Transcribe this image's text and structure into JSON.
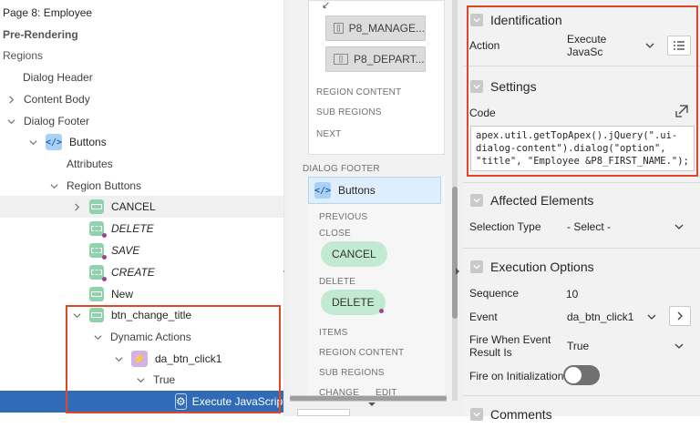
{
  "tree": {
    "page_title": "Page 8: Employee",
    "pre_rendering": "Pre-Rendering",
    "regions": "Regions",
    "dialog_header": "Dialog Header",
    "content_body": "Content Body",
    "dialog_footer": "Dialog Footer",
    "buttons": "Buttons",
    "attributes": "Attributes",
    "region_buttons": "Region Buttons",
    "btn_cancel": "CANCEL",
    "btn_delete": "DELETE",
    "btn_save": "SAVE",
    "btn_create": "CREATE",
    "btn_new": "New",
    "btn_change_title": "btn_change_title",
    "dynamic_actions": "Dynamic Actions",
    "da_btn_click1": "da_btn_click1",
    "true_branch": "True",
    "execute_js": "Execute JavaScript"
  },
  "mid": {
    "chip_manage": "P8_MANAGE...",
    "chip_depart": "P8_DEPART...",
    "region_content": "REGION CONTENT",
    "sub_regions": "SUB REGIONS",
    "next": "NEXT",
    "dialog_footer": "DIALOG FOOTER",
    "buttons_header": "Buttons",
    "previous": "PREVIOUS",
    "close": "CLOSE",
    "cancel_pill": "CANCEL",
    "delete_label": "DELETE",
    "delete_pill": "DELETE",
    "items": "ITEMS",
    "region_content2": "REGION CONTENT",
    "sub_regions2": "SUB REGIONS",
    "change": "CHANGE",
    "edit": "EDIT"
  },
  "right": {
    "identification": "Identification",
    "action_label": "Action",
    "action_value": "Execute JavaSc",
    "settings": "Settings",
    "code_label": "Code",
    "code_value": "apex.util.getTopApex().jQuery(\".ui-dialog-content\").dialog(\"option\", \"title\", \"Employee &P8_FIRST_NAME.\");",
    "affected_elements": "Affected Elements",
    "selection_type_label": "Selection Type",
    "selection_type_value": "- Select -",
    "execution_options": "Execution Options",
    "sequence_label": "Sequence",
    "sequence_value": "10",
    "event_label": "Event",
    "event_value": "da_btn_click1",
    "fire_when_label_1": "Fire When Event",
    "fire_when_label_2": "Result Is",
    "fire_when_value": "True",
    "fire_on_init_label": "Fire on Initialization",
    "comments": "Comments"
  },
  "colors": {
    "highlight": "#e0462a",
    "selected_row": "#2f6bb7",
    "button_icon": "#8fd3ad",
    "pill": "#c2ead3",
    "accent_dot": "#a0448c"
  }
}
